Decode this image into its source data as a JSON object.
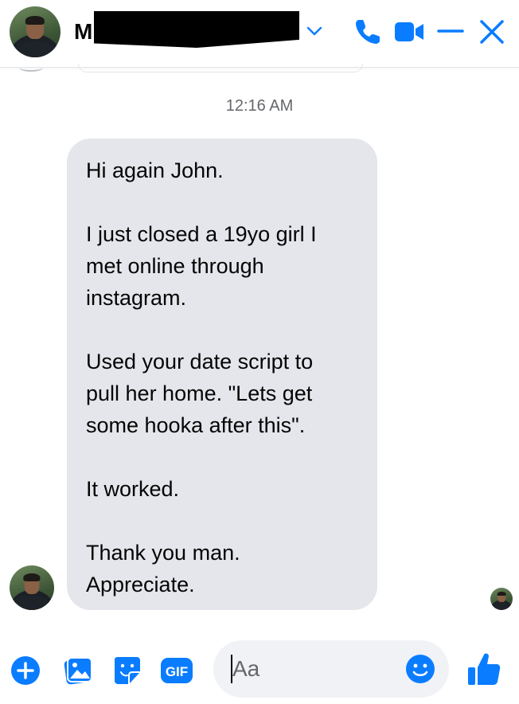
{
  "header": {
    "contact_initial": "M",
    "actions": [
      "chevron-down-icon",
      "phone-icon",
      "video-camera-icon",
      "minimize-icon",
      "close-icon"
    ]
  },
  "conversation": {
    "timestamp": "12:16 AM",
    "message": {
      "paragraphs": [
        "Hi again John.",
        "I just closed a 19yo girl I\nmet online through\ninstagram.",
        "Used your date script to\npull her home. \"Lets get\nsome hooka after this\".",
        "It worked.",
        "Thank you man.\nAppreciate."
      ]
    }
  },
  "composer": {
    "placeholder": "Aa",
    "gif_label": "GIF"
  },
  "colors": {
    "accent": "#0a7cff",
    "bubble": "#e4e6eb",
    "timestamp": "#65676b"
  }
}
